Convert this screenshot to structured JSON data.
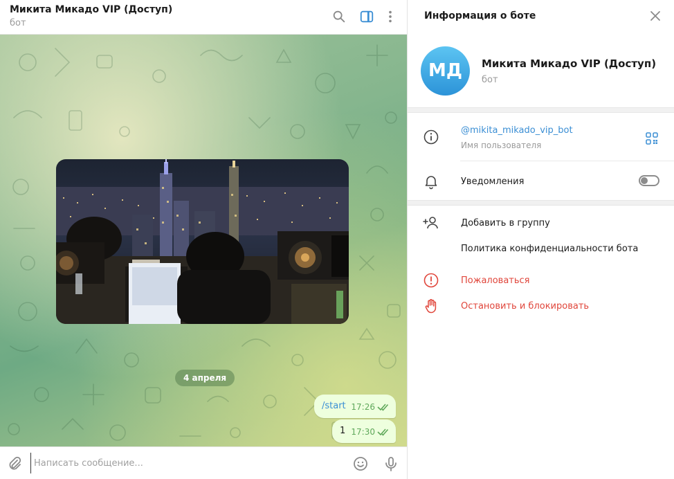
{
  "chat": {
    "title": "Микита Микадо VIP (Доступ)",
    "subtitle": "бот",
    "header_icons": [
      "search-icon",
      "sidebar-toggle-icon",
      "more-vertical-icon"
    ],
    "date_separator": "4 апреля",
    "messages": [
      {
        "text": "/start",
        "time": "17:26",
        "status": "read"
      },
      {
        "text": "1",
        "time": "17:30",
        "status": "read"
      }
    ],
    "composer": {
      "placeholder": "Написать сообщение...",
      "value": ""
    },
    "colors": {
      "accent": "#3a8ed4",
      "bubble": "#eeffde",
      "check": "#5fa85a"
    }
  },
  "info_panel": {
    "title": "Информация о боте",
    "avatar_initials": "МД",
    "name": "Микита Микадо VIP (Доступ)",
    "subtitle": "бот",
    "username": "@mikita_mikado_vip_bot",
    "username_caption": "Имя пользователя",
    "notifications_label": "Уведомления",
    "notifications_enabled": false,
    "add_to_group": "Добавить в группу",
    "privacy_policy": "Политика конфиденциальности бота",
    "report": "Пожаловаться",
    "block": "Остановить и блокировать",
    "colors": {
      "danger": "#e0453a",
      "avatar_top": "#5cc4f2",
      "avatar_bottom": "#2c93d8"
    }
  }
}
